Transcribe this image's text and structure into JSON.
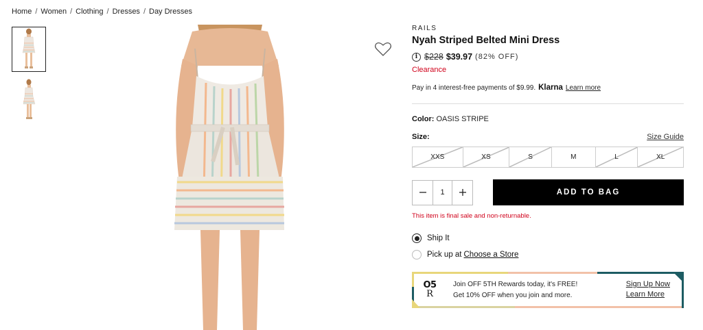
{
  "breadcrumb": [
    "Home",
    "Women",
    "Clothing",
    "Dresses",
    "Day Dresses"
  ],
  "product": {
    "brand": "RAILS",
    "title": "Nyah Striped Belted Mini Dress",
    "old_price": "$228",
    "price": "$39.97",
    "discount": "(82% OFF)",
    "clearance": "Clearance",
    "klarna_text": "Pay in 4 interest-free payments of $9.99.",
    "klarna_brand": "Klarna",
    "klarna_link": "Learn more",
    "color_label": "Color:",
    "color_value": "OASIS STRIPE",
    "size_label": "Size:",
    "size_guide": "Size Guide",
    "sizes": [
      "XXS",
      "XS",
      "S",
      "M",
      "L",
      "XL"
    ],
    "quantity": "1",
    "add_to_bag": "ADD TO BAG",
    "final_sale": "This item is final sale and non-returnable.",
    "ship_it": "Ship It",
    "pickup": "Pick up at",
    "choose_store": "Choose a Store"
  },
  "rewards": {
    "logo_top": "O5",
    "logo_bottom": "R",
    "headline": "Join OFF 5TH Rewards today, it's FREE!",
    "sub": "Get 10% OFF when you join and more.",
    "sign_up": "Sign Up Now",
    "learn_more": "Learn More"
  },
  "colors": {
    "accent_red": "#d0021b",
    "button_black": "#000000",
    "rewards_teal": "#1d5c63",
    "rewards_yellow": "#e8d67a",
    "rewards_peach": "#f2c1a8"
  }
}
